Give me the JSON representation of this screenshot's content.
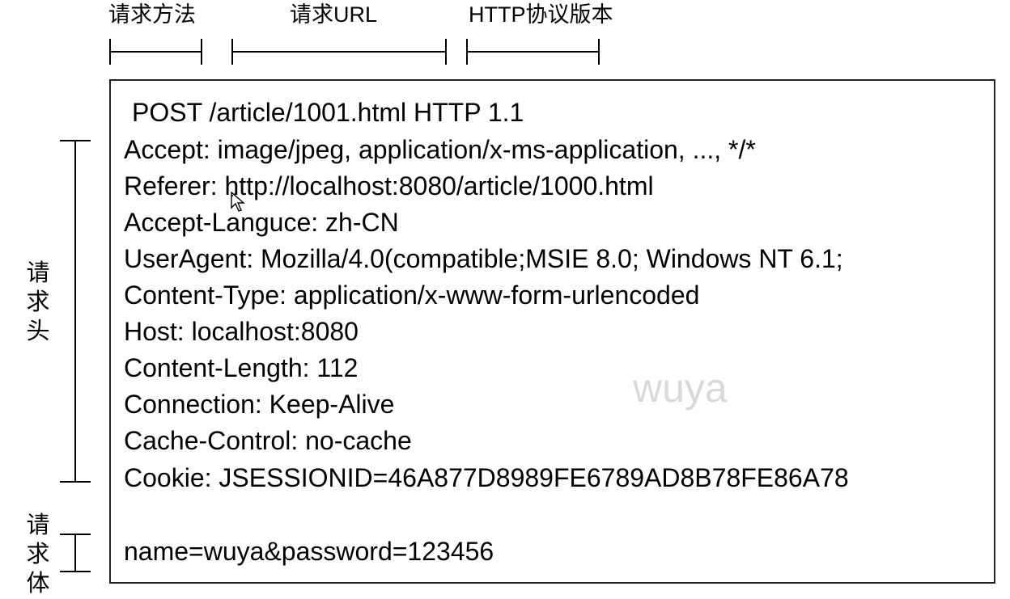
{
  "labels": {
    "method": "请求方法",
    "url": "请求URL",
    "version": "HTTP协议版本",
    "headers": "请求头",
    "body": "请求体"
  },
  "request": {
    "request_line": "POST /article/1001.html HTTP 1.1",
    "headers": [
      "Accept: image/jpeg, application/x-ms-application, ..., */*",
      "Referer: http://localhost:8080/article/1000.html",
      "Accept-Languce: zh-CN",
      "UserAgent: Mozilla/4.0(compatible;MSIE 8.0; Windows NT 6.1;",
      "Content-Type: application/x-www-form-urlencoded",
      "Host: localhost:8080",
      "Content-Length: 112",
      "Connection: Keep-Alive",
      "Cache-Control: no-cache",
      "Cookie: JSESSIONID=46A877D8989FE6789AD8B78FE86A78"
    ],
    "body": "name=wuya&password=123456"
  },
  "watermark": "wuya",
  "colors": {
    "text": "#000000",
    "watermark": "#dadada"
  },
  "icons": {
    "cursor": "mouse-pointer-icon"
  }
}
